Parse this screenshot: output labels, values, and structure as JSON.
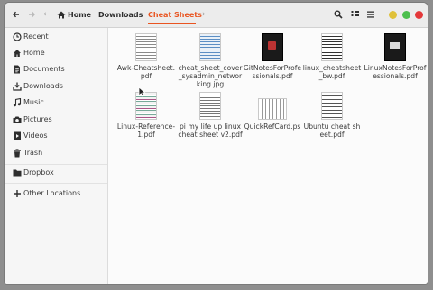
{
  "nav": {
    "back": "back-arrow",
    "forward": "forward-arrow"
  },
  "breadcrumb": [
    {
      "label": "Home",
      "current": false
    },
    {
      "label": "Downloads",
      "current": false
    },
    {
      "label": "Cheat Sheets",
      "current": true
    }
  ],
  "colors": {
    "accent": "#e95420",
    "minimize": "#e0c13a",
    "maximize": "#4cbf4d",
    "close": "#e4383a"
  },
  "sidebar": {
    "items": [
      {
        "label": "Recent",
        "icon": "clock-icon"
      },
      {
        "label": "Home",
        "icon": "home-icon"
      },
      {
        "label": "Documents",
        "icon": "document-icon"
      },
      {
        "label": "Downloads",
        "icon": "download-icon"
      },
      {
        "label": "Music",
        "icon": "music-icon"
      },
      {
        "label": "Pictures",
        "icon": "camera-icon"
      },
      {
        "label": "Videos",
        "icon": "video-icon"
      },
      {
        "label": "Trash",
        "icon": "trash-icon"
      },
      {
        "label": "Dropbox",
        "icon": "folder-icon"
      },
      {
        "label": "Other Locations",
        "icon": "plus-icon"
      }
    ]
  },
  "files": [
    {
      "name": "Awk-Cheatsheet.pdf",
      "thumb": "table-doc"
    },
    {
      "name": "cheat_sheet_cover_sysadmin_networking.jpg",
      "thumb": "blue-doc"
    },
    {
      "name": "GitNotesForProfessionals.pdf",
      "thumb": "dark-book"
    },
    {
      "name": "linux_cheatsheet_bw.pdf",
      "thumb": "text-doc"
    },
    {
      "name": "LinuxNotesForProfessionals.pdf",
      "thumb": "dark-book"
    },
    {
      "name": "Linux-Reference-1.pdf",
      "thumb": "color-doc"
    },
    {
      "name": "pi my life up linux cheat sheet v2.pdf",
      "thumb": "text-doc"
    },
    {
      "name": "QuickRefCard.ps",
      "thumb": "landscape-doc"
    },
    {
      "name": "Ubuntu cheat sheet.pdf",
      "thumb": "text-doc"
    }
  ]
}
